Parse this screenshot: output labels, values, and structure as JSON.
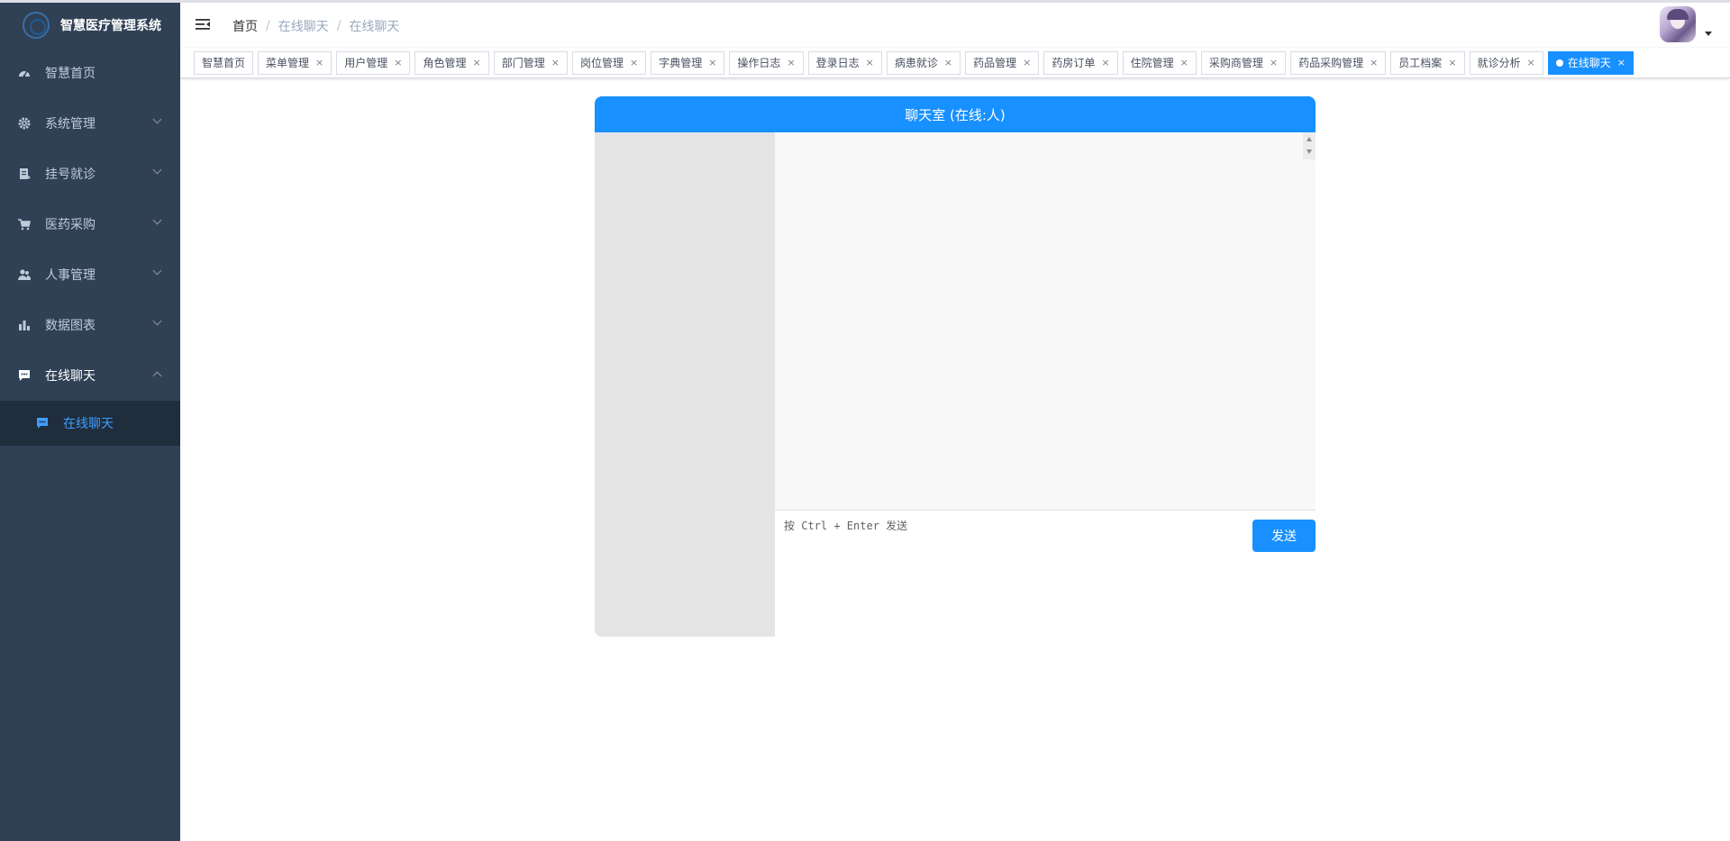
{
  "app": {
    "title": "智慧医疗管理系统"
  },
  "sidebar": {
    "items": [
      {
        "label": "智慧首页",
        "icon": "dashboard-icon"
      },
      {
        "label": "系统管理",
        "icon": "gear-icon"
      },
      {
        "label": "挂号就诊",
        "icon": "register-icon"
      },
      {
        "label": "医药采购",
        "icon": "cart-icon"
      },
      {
        "label": "人事管理",
        "icon": "people-icon"
      },
      {
        "label": "数据图表",
        "icon": "bar-chart-icon"
      },
      {
        "label": "在线聊天",
        "icon": "chat-icon",
        "expanded": true
      }
    ],
    "submenu": [
      {
        "label": "在线聊天",
        "icon": "chat-icon",
        "active": true
      }
    ]
  },
  "navbar": {
    "breadcrumb": [
      "首页",
      "在线聊天",
      "在线聊天"
    ]
  },
  "tags": [
    {
      "label": "智慧首页",
      "closable": false
    },
    {
      "label": "菜单管理",
      "closable": true
    },
    {
      "label": "用户管理",
      "closable": true
    },
    {
      "label": "角色管理",
      "closable": true
    },
    {
      "label": "部门管理",
      "closable": true
    },
    {
      "label": "岗位管理",
      "closable": true
    },
    {
      "label": "字典管理",
      "closable": true
    },
    {
      "label": "操作日志",
      "closable": true
    },
    {
      "label": "登录日志",
      "closable": true
    },
    {
      "label": "病患就诊",
      "closable": true
    },
    {
      "label": "药品管理",
      "closable": true
    },
    {
      "label": "药房订单",
      "closable": true
    },
    {
      "label": "住院管理",
      "closable": true
    },
    {
      "label": "采购商管理",
      "closable": true
    },
    {
      "label": "药品采购管理",
      "closable": true
    },
    {
      "label": "员工档案",
      "closable": true
    },
    {
      "label": "就诊分析",
      "closable": true
    },
    {
      "label": "在线聊天",
      "closable": true,
      "active": true
    }
  ],
  "chat": {
    "title": "聊天室 (在线:人)",
    "input_placeholder": "按 Ctrl + Enter 发送",
    "send_label": "发送"
  },
  "colors": {
    "sidebar_bg": "#304156",
    "accent": "#1890ff",
    "submenu_active": "#409eff"
  }
}
